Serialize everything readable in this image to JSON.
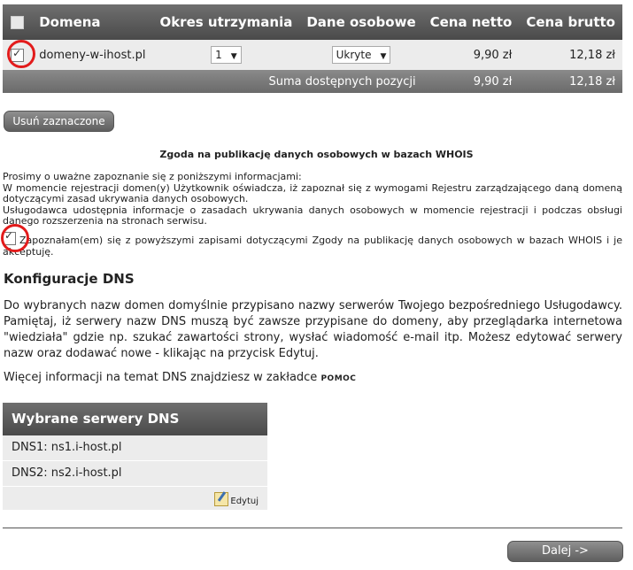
{
  "cart": {
    "headers": {
      "domain": "Domena",
      "period": "Okres utrzymania",
      "personal": "Dane osobowe",
      "net": "Cena netto",
      "gross": "Cena brutto"
    },
    "row": {
      "checked": true,
      "domain": "domeny-w-ihost.pl",
      "period": "1",
      "personal": "Ukryte",
      "net": "9,90 zł",
      "gross": "12,18 zł"
    },
    "sum": {
      "label": "Suma dostępnych pozycji",
      "net": "9,90 zł",
      "gross": "12,18 zł"
    }
  },
  "remove_button": "Usuń zaznaczone",
  "consent": {
    "title": "Zgoda na publikację danych osobowych w bazach WHOIS",
    "intro": "Prosimy o uważne zapoznanie się z poniższymi informacjami:",
    "p1": "W momencie rejestracji domen(y) Użytkownik oświadcza, iż zapoznał się z wymogami Rejestru zarządzającego daną domeną dotyczącymi zasad ukrywania danych osobowych.",
    "p2": "Usługodawca udostępnia informacje o zasadach ukrywania danych osobowych w momencie rejestracji i podczas obsługi danego rozszerzenia na stronach serwisu.",
    "agree": "Zapoznałam(em) się z powyższymi zapisami dotyczącymi Zgody na publikację danych osobowych w bazach WHOIS i je akceptuję."
  },
  "dns_config": {
    "heading": "Konfiguracje DNS",
    "text": "Do wybranych nazw domen domyślnie przypisano nazwy serwerów Twojego bezpośredniego Usługodawcy. Pamiętaj, iż serwery nazw DNS muszą być zawsze przypisane do domeny, aby przeglądarka internetowa \"wiedziała\" gdzie np. szukać zawartości strony, wysłać wiadomość e-mail itp. Możesz edytować serwery nazw oraz dodawać nowe - klikając na przycisk Edytuj.",
    "more_prefix": "Więcej informacji na temat DNS znajdziesz w zakładce",
    "more_link": "POMOC"
  },
  "dns_box": {
    "title": "Wybrane serwery DNS",
    "servers": [
      "DNS1: ns1.i-host.pl",
      "DNS2: ns2.i-host.pl"
    ],
    "edit_label": "Edytuj"
  },
  "next_button": "Dalej ->",
  "colors": {
    "highlight_circle": "#e21b1b",
    "header_bg": "#5a5a5a"
  }
}
